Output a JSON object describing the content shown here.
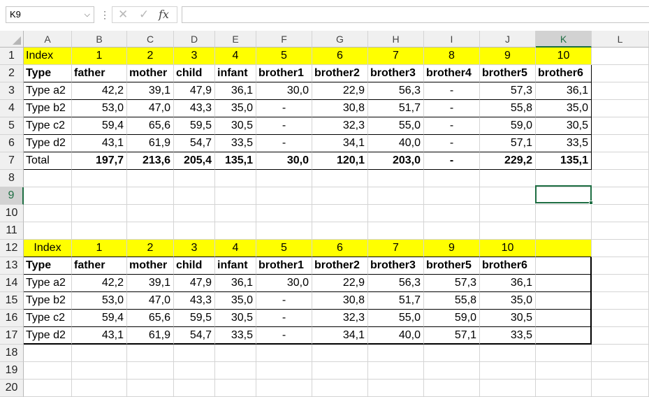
{
  "formula_bar": {
    "name_box": "K9",
    "cancel_icon": "✕",
    "enter_icon": "✓",
    "function_icon": "fx",
    "formula": ""
  },
  "columns": [
    "A",
    "B",
    "C",
    "D",
    "E",
    "F",
    "G",
    "H",
    "I",
    "J",
    "K",
    "L"
  ],
  "selected_column": "K",
  "selected_row": 9,
  "rows": [
    "1",
    "2",
    "3",
    "4",
    "5",
    "6",
    "7",
    "8",
    "9",
    "10",
    "11",
    "12",
    "13",
    "14",
    "15",
    "16",
    "17",
    "18",
    "19",
    "20"
  ],
  "table1": {
    "index_row": [
      "Index",
      "1",
      "2",
      "3",
      "4",
      "5",
      "6",
      "7",
      "8",
      "9",
      "10"
    ],
    "header_row": [
      "Type",
      "father",
      "mother",
      "child",
      "infant",
      "brother1",
      "brother2",
      "brother3",
      "brother4",
      "brother5",
      "brother6"
    ],
    "data_rows": [
      [
        "Type a2",
        "42,2",
        "39,1",
        "47,9",
        "36,1",
        "30,0",
        "22,9",
        "56,3",
        "-",
        "57,3",
        "36,1"
      ],
      [
        "Type b2",
        "53,0",
        "47,0",
        "43,3",
        "35,0",
        "-",
        "30,8",
        "51,7",
        "-",
        "55,8",
        "35,0"
      ],
      [
        "Type c2",
        "59,4",
        "65,6",
        "59,5",
        "30,5",
        "-",
        "32,3",
        "55,0",
        "-",
        "59,0",
        "30,5"
      ],
      [
        "Type d2",
        "43,1",
        "61,9",
        "54,7",
        "33,5",
        "-",
        "34,1",
        "40,0",
        "-",
        "57,1",
        "33,5"
      ]
    ],
    "total_row": [
      "Total",
      "197,7",
      "213,6",
      "205,4",
      "135,1",
      "30,0",
      "120,1",
      "203,0",
      "-",
      "229,2",
      "135,1"
    ]
  },
  "table2": {
    "index_row": [
      "Index",
      "1",
      "2",
      "3",
      "4",
      "5",
      "6",
      "7",
      "9",
      "10",
      ""
    ],
    "header_row": [
      "Type",
      "father",
      "mother",
      "child",
      "infant",
      "brother1",
      "brother2",
      "brother3",
      "brother5",
      "brother6",
      ""
    ],
    "data_rows": [
      [
        "Type a2",
        "42,2",
        "39,1",
        "47,9",
        "36,1",
        "30,0",
        "22,9",
        "56,3",
        "57,3",
        "36,1",
        ""
      ],
      [
        "Type b2",
        "53,0",
        "47,0",
        "43,3",
        "35,0",
        "-",
        "30,8",
        "51,7",
        "55,8",
        "35,0",
        ""
      ],
      [
        "Type c2",
        "59,4",
        "65,6",
        "59,5",
        "30,5",
        "-",
        "32,3",
        "55,0",
        "59,0",
        "30,5",
        ""
      ],
      [
        "Type d2",
        "43,1",
        "61,9",
        "54,7",
        "33,5",
        "-",
        "34,1",
        "40,0",
        "57,1",
        "33,5",
        ""
      ]
    ]
  },
  "colors": {
    "highlight": "#ffff00",
    "selection": "#1e6e43",
    "header_bg": "#f0f0f0",
    "gridline": "#d4d4d4"
  }
}
